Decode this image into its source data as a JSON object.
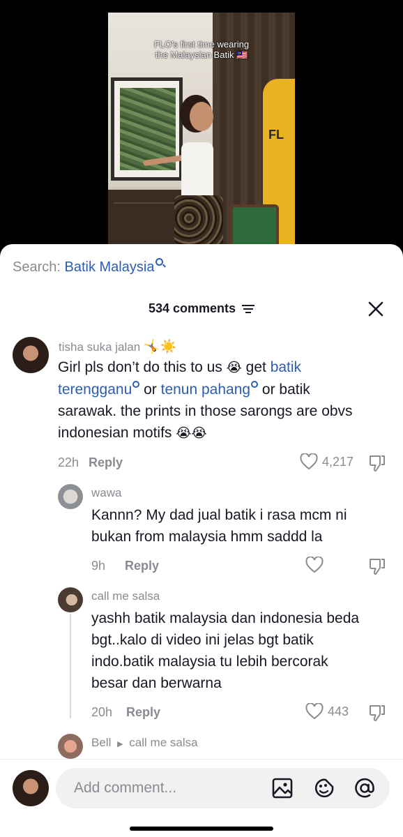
{
  "video": {
    "caption_line1": "FLO's first time wearing",
    "caption_line2": "the Malaysian Batik 🇲🇾",
    "sign_text": "FL"
  },
  "search": {
    "prefix": "Search:",
    "query": "Batik Malaysia"
  },
  "comments_header": {
    "count_label": "534 comments"
  },
  "comments": [
    {
      "username": "tisha suka jalan",
      "username_emoji": "🤸☀️",
      "text_parts": {
        "p1": "Girl pls don’t do this to us ",
        "e1": "😭",
        "p2": " get ",
        "link1a": "batik",
        "link1b": "terengganu",
        "p3": " or ",
        "link2": "tenun pahang",
        "p4": " or batik",
        "line3": "sarawak. the prints in those sarongs are obvs",
        "line4": "indonesian motifs ",
        "e2": "😭😭"
      },
      "time": "22h",
      "reply_label": "Reply",
      "likes": "4,217"
    },
    {
      "username": "wawa",
      "line1": "Kannn? My dad jual batik i rasa mcm ni",
      "line2": "bukan from malaysia hmm saddd la",
      "time": "9h",
      "reply_label": "Reply",
      "likes": ""
    },
    {
      "username": "call me salsa",
      "line1": "yashh batik malaysia dan indonesia beda",
      "line2": "bgt..kalo di video ini jelas bgt batik",
      "line3": "indo.batik malaysia tu lebih bercorak",
      "line4": "besar dan berwarna",
      "time": "20h",
      "reply_label": "Reply",
      "likes": "443"
    },
    {
      "username": "Bell",
      "reply_to": "call me salsa"
    }
  ],
  "composer": {
    "placeholder": "Add comment..."
  },
  "colors": {
    "link": "#2b5db3",
    "muted": "#8a8b91",
    "text": "#161823"
  }
}
